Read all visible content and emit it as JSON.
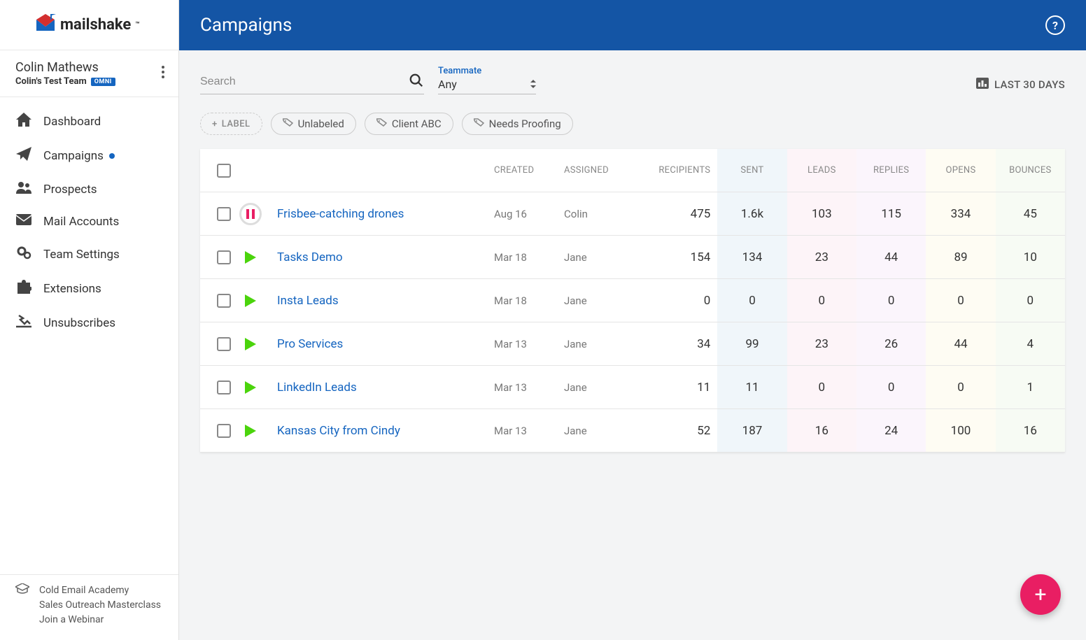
{
  "brand": "mailshake",
  "user": {
    "name": "Colin Mathews",
    "team": "Colin's Test Team",
    "plan_badge": "OMNI"
  },
  "nav": [
    {
      "label": "Dashboard",
      "icon": "home-icon",
      "active": false
    },
    {
      "label": "Campaigns",
      "icon": "paper-plane-icon",
      "active": true
    },
    {
      "label": "Prospects",
      "icon": "users-icon",
      "active": false
    },
    {
      "label": "Mail Accounts",
      "icon": "envelope-icon",
      "active": false
    },
    {
      "label": "Team Settings",
      "icon": "gears-icon",
      "active": false
    },
    {
      "label": "Extensions",
      "icon": "puzzle-icon",
      "active": false
    },
    {
      "label": "Unsubscribes",
      "icon": "unsubscribe-icon",
      "active": false
    }
  ],
  "sidebar_links": {
    "a": "Cold Email Academy",
    "b": "Sales Outreach Masterclass",
    "c": "Join a Webinar"
  },
  "header": {
    "title": "Campaigns"
  },
  "filters": {
    "search_placeholder": "Search",
    "teammate_label": "Teammate",
    "teammate_value": "Any",
    "date_range": "LAST 30 DAYS"
  },
  "labels": {
    "add": "LABEL",
    "items": [
      "Unlabeled",
      "Client ABC",
      "Needs Proofing"
    ]
  },
  "columns": {
    "created": "CREATED",
    "assigned": "ASSIGNED",
    "recipients": "RECIPIENTS",
    "sent": "SENT",
    "leads": "LEADS",
    "replies": "REPLIES",
    "opens": "OPENS",
    "bounces": "BOUNCES"
  },
  "rows": [
    {
      "status": "paused",
      "name": "Frisbee-catching drones",
      "created": "Aug 16",
      "assigned": "Colin",
      "recipients": "475",
      "sent": "1.6k",
      "leads": "103",
      "replies": "115",
      "opens": "334",
      "bounces": "45"
    },
    {
      "status": "running",
      "name": "Tasks Demo",
      "created": "Mar 18",
      "assigned": "Jane",
      "recipients": "154",
      "sent": "134",
      "leads": "23",
      "replies": "44",
      "opens": "89",
      "bounces": "10"
    },
    {
      "status": "running",
      "name": "Insta Leads",
      "created": "Mar 18",
      "assigned": "Jane",
      "recipients": "0",
      "sent": "0",
      "leads": "0",
      "replies": "0",
      "opens": "0",
      "bounces": "0"
    },
    {
      "status": "running",
      "name": "Pro Services",
      "created": "Mar 13",
      "assigned": "Jane",
      "recipients": "34",
      "sent": "99",
      "leads": "23",
      "replies": "26",
      "opens": "44",
      "bounces": "4"
    },
    {
      "status": "running",
      "name": "LinkedIn Leads",
      "created": "Mar 13",
      "assigned": "Jane",
      "recipients": "11",
      "sent": "11",
      "leads": "0",
      "replies": "0",
      "opens": "0",
      "bounces": "1"
    },
    {
      "status": "running",
      "name": "Kansas City from Cindy",
      "created": "Mar 13",
      "assigned": "Jane",
      "recipients": "52",
      "sent": "187",
      "leads": "16",
      "replies": "24",
      "opens": "100",
      "bounces": "16"
    }
  ]
}
